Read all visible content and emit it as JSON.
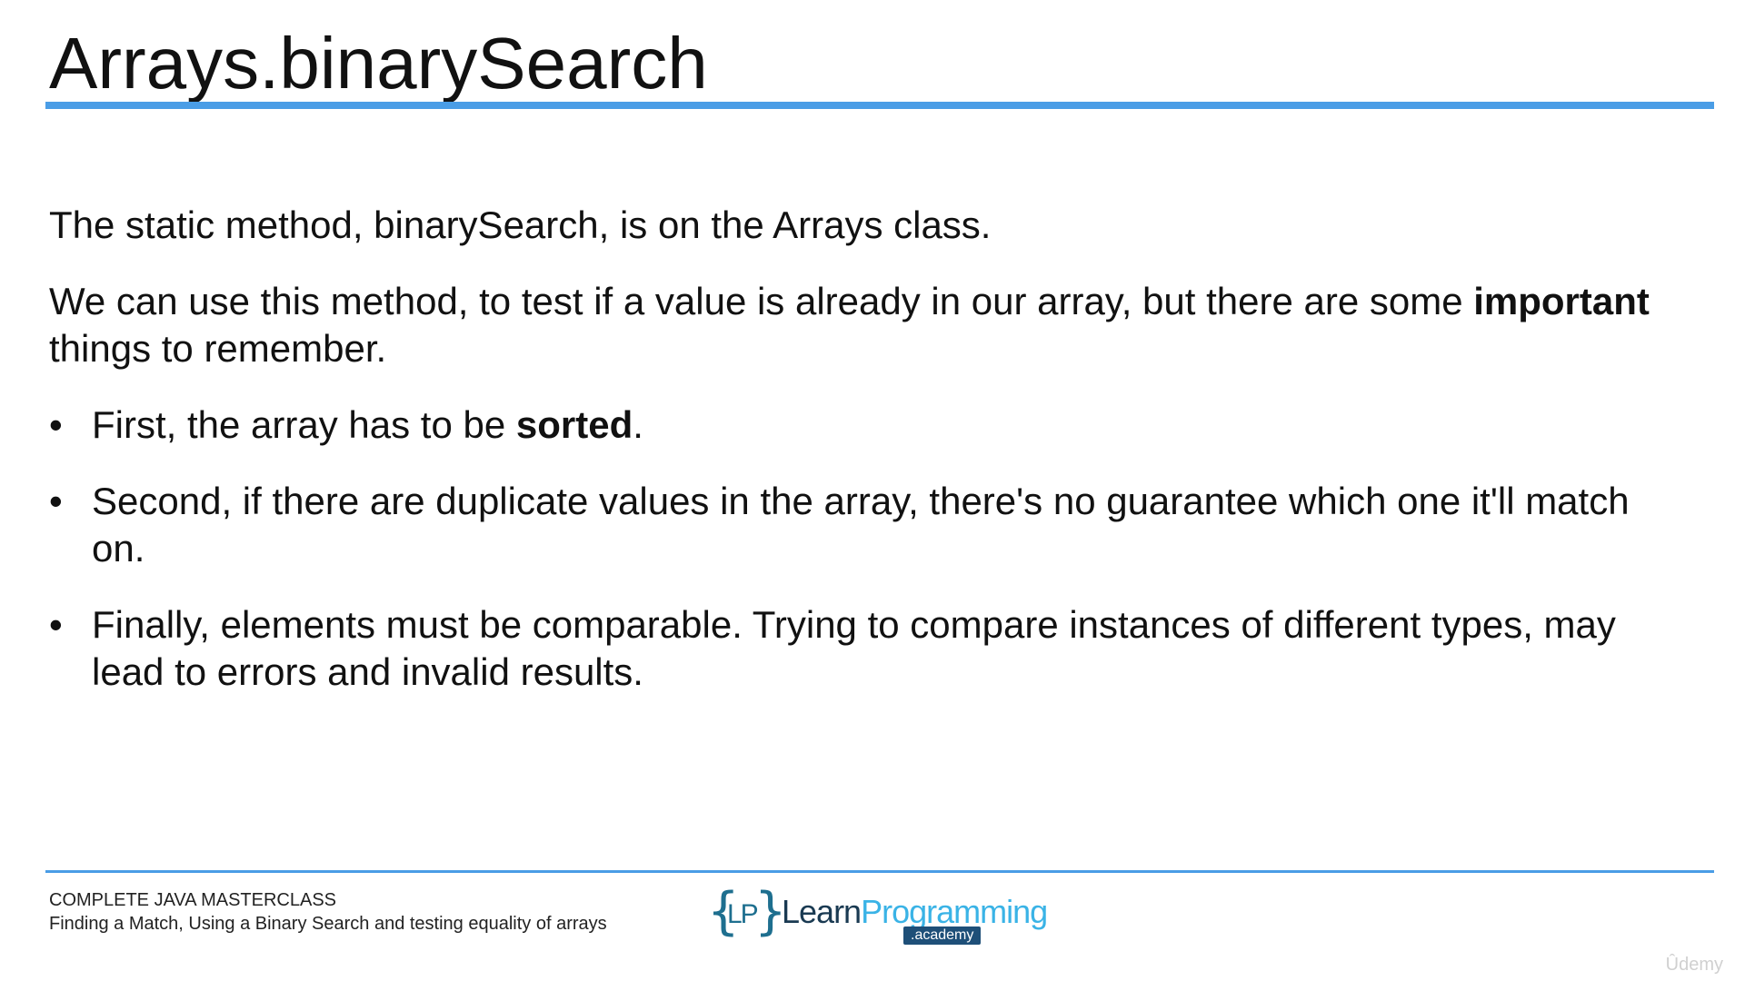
{
  "slide": {
    "title": "Arrays.binarySearch",
    "paragraph1": "The static method, binarySearch, is on the Arrays class.",
    "paragraph2": {
      "before": "We can use this method, to test if a value is already in our array, but there are some ",
      "bold": "important",
      "after": " things to remember."
    },
    "bullets": [
      {
        "marker": "•",
        "before": "First, the array has to be ",
        "bold": "sorted",
        "after": "."
      },
      {
        "marker": "•",
        "before": "Second, if there are duplicate values in the array, there's no guarantee which one it'll match on.",
        "bold": "",
        "after": ""
      },
      {
        "marker": "•",
        "before": "Finally, elements must be comparable.  Trying to compare instances of different types, may lead to errors and invalid results.",
        "bold": "",
        "after": ""
      }
    ]
  },
  "footer": {
    "course": "COMPLETE JAVA MASTERCLASS",
    "lecture": "Finding a Match, Using a Binary Search and testing equality of arrays"
  },
  "logo": {
    "brace_left": "{",
    "monogram": "LP",
    "brace_right": "}",
    "word_learn": "Learn",
    "word_programming": "Programming",
    "badge": ".academy"
  },
  "watermark": "Ûdemy",
  "colors": {
    "accent_rule": "#4a9de6",
    "logo_dark": "#1a3a52",
    "logo_light": "#3ab3e6",
    "logo_badge": "#1e4f78"
  }
}
